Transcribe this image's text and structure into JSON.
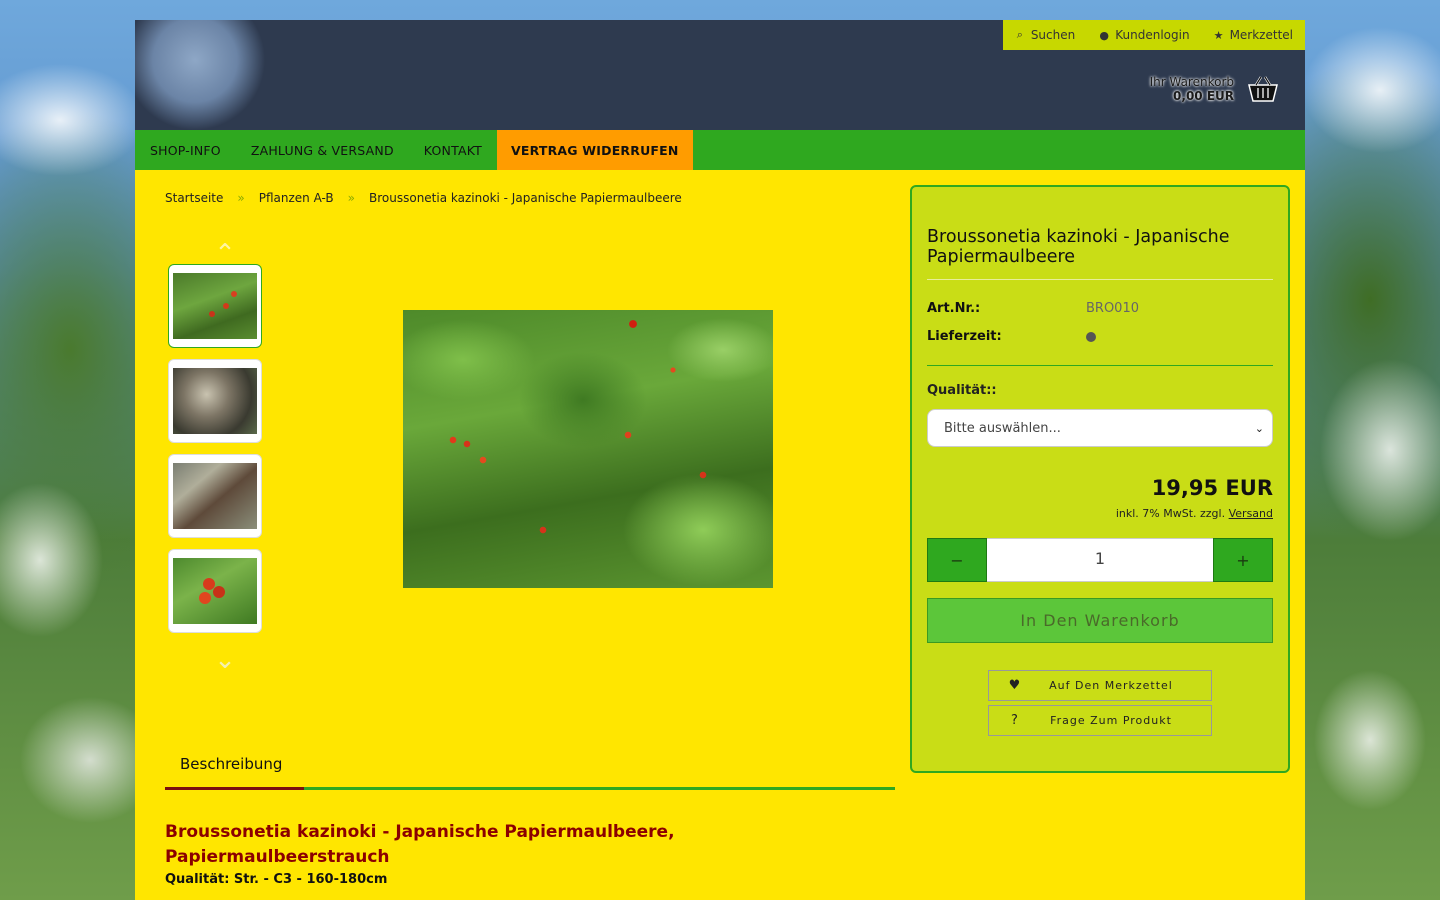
{
  "topnav": {
    "search": {
      "icon": "search-icon",
      "label": "Suchen"
    },
    "login": {
      "icon": "user-icon",
      "label": "Kundenlogin"
    },
    "wishlist": {
      "icon": "star-icon",
      "label": "Merkzettel"
    }
  },
  "cart": {
    "label": "Ihr Warenkorb",
    "sum": "0,00 EUR",
    "icon": "basket-icon"
  },
  "mainnav": {
    "items": [
      {
        "label": "Shop-Info"
      },
      {
        "label": "Zahlung & Versand"
      },
      {
        "label": "Kontakt"
      },
      {
        "label": "Vertrag widerrufen"
      }
    ]
  },
  "breadcrumb": {
    "items": [
      "Startseite",
      "Pflanzen A-B",
      "Broussonetia kazinoki - Japanische Papiermaulbeere"
    ],
    "separator": "»"
  },
  "gallery": {
    "up_icon": "chevron-up-icon",
    "down_icon": "chevron-down-icon",
    "thumbnails": 4
  },
  "product": {
    "title": "Broussonetia kazinoki - Japanische Papiermaulbeere",
    "artnr_label": "Art.Nr.:",
    "artnr": "BRO010",
    "delivery_label": "Lieferzeit:",
    "quality_label": "Qualität::",
    "quality_placeholder": "Bitte auswählen...",
    "price": "19,95 EUR",
    "tax_text": "inkl. 7% MwSt. zzgl.",
    "shipping_link": "Versand",
    "quantity": "1",
    "add_to_cart": "In Den Warenkorb",
    "wishlist_button": "Auf Den Merkzettel",
    "question_button": "Frage Zum Produkt"
  },
  "tabs": [
    {
      "label": "Beschreibung"
    }
  ],
  "description": {
    "title": "Broussonetia kazinoki - Japanische Papiermaulbeere, Papiermaulbeerstrauch",
    "quality": "Qualität: Str. - C3 - 160-180cm"
  },
  "colors": {
    "page_bg": "#ffe600",
    "nav_green": "#2fa81f",
    "active_orange": "#ff9c00",
    "box_bg": "#c9dd16",
    "title_red": "#8b0000"
  }
}
